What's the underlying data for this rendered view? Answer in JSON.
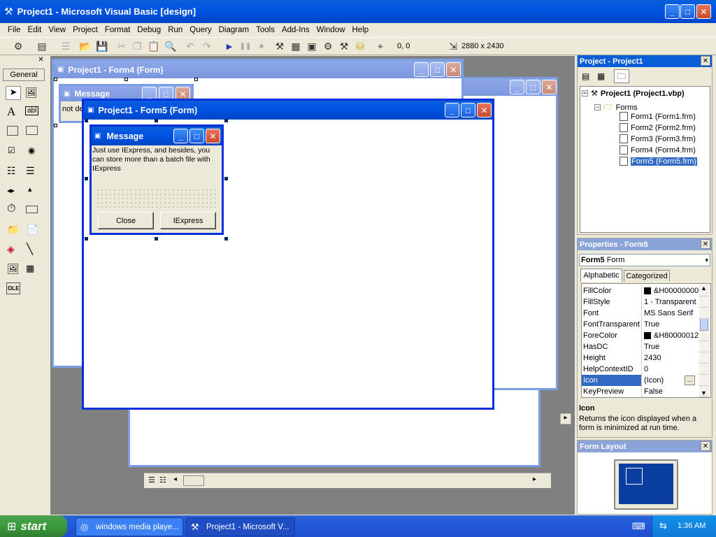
{
  "window": {
    "title": "Project1 - Microsoft Visual Basic [design]"
  },
  "menu": [
    "File",
    "Edit",
    "View",
    "Project",
    "Format",
    "Debug",
    "Run",
    "Query",
    "Diagram",
    "Tools",
    "Add-Ins",
    "Window",
    "Help"
  ],
  "toolbar": {
    "position_readout": "0, 0",
    "size_readout": "2880 x 2430"
  },
  "toolbox": {
    "tab_label": "General"
  },
  "forms": {
    "form4_title": "Project1 - Form4 (Form)",
    "form5_title": "Project1 - Form5 (Form)",
    "message_title": "Message",
    "message_behind_title": "Message",
    "message_behind_text": "not de",
    "message_text": "Just use IExpress, and besides, you can store more than a batch file with IExpress",
    "close_button": "Close",
    "iexpress_button": "IExpress"
  },
  "project_panel": {
    "title": "Project - Project1",
    "root": "Project1 (Project1.vbp)",
    "folder": "Forms",
    "items": [
      "Form1 (Form1.frm)",
      "Form2 (Form2.frm)",
      "Form3 (Form3.frm)",
      "Form4 (Form4.frm)",
      "Form5 (Form5.frm)"
    ]
  },
  "properties_panel": {
    "title": "Properties - Form5",
    "object_name": "Form5",
    "object_type": "Form",
    "tab_alphabetic": "Alphabetic",
    "tab_categorized": "Categorized",
    "rows": [
      {
        "name": "FillColor",
        "value": "&H00000000"
      },
      {
        "name": "FillStyle",
        "value": "1 - Transparent"
      },
      {
        "name": "Font",
        "value": "MS Sans Serif"
      },
      {
        "name": "FontTransparent",
        "value": "True"
      },
      {
        "name": "ForeColor",
        "value": "&H80000012"
      },
      {
        "name": "HasDC",
        "value": "True"
      },
      {
        "name": "Height",
        "value": "2430"
      },
      {
        "name": "HelpContextID",
        "value": "0"
      },
      {
        "name": "Icon",
        "value": "(Icon)"
      },
      {
        "name": "KeyPreview",
        "value": "False"
      }
    ],
    "desc_title": "Icon",
    "desc_text": "Returns the icon displayed when a form is minimized at run time."
  },
  "layout_panel": {
    "title": "Form Layout"
  },
  "taskbar": {
    "start_label": "start",
    "items": [
      "windows media playe...",
      "Project1 - Microsoft V..."
    ],
    "clock": "1:36 AM"
  },
  "colors": {
    "xp_blue": "#0054e3",
    "selection": "#316ac5",
    "taskbar": "#245edb",
    "start_green": "#3c9b3c"
  }
}
